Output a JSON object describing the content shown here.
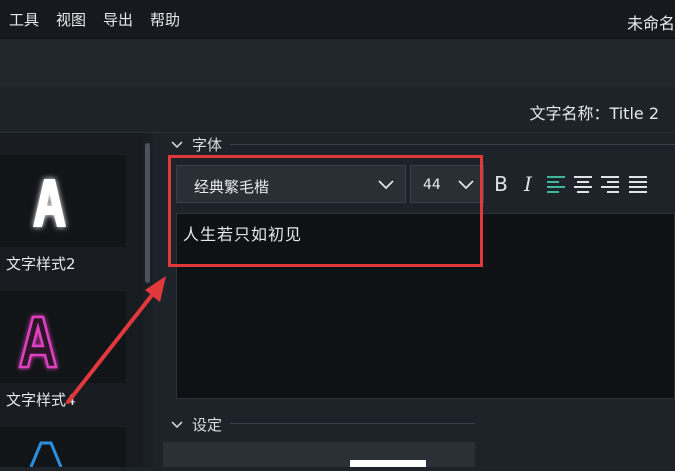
{
  "menu": {
    "items": [
      "工具",
      "视图",
      "导出",
      "帮助"
    ],
    "doc_title": "未命名"
  },
  "name_row": {
    "label": "文字名称：Title 2"
  },
  "styles": {
    "items": [
      {
        "label": "文字样式2",
        "icon": "letter-a-white-glow"
      },
      {
        "label": "文字样式4",
        "icon": "letter-a-pink-neon"
      },
      {
        "label": "",
        "icon": "letter-a-blue-neon"
      }
    ]
  },
  "font_section": {
    "title": "字体",
    "font_family": "经典繁毛楷",
    "font_size": "44",
    "bold_label": "B",
    "italic_label": "I",
    "text": "人生若只如初见"
  },
  "settings_section": {
    "title": "设定"
  },
  "colors": {
    "highlight": "#e0383b",
    "align_active": "#3fb89a"
  }
}
